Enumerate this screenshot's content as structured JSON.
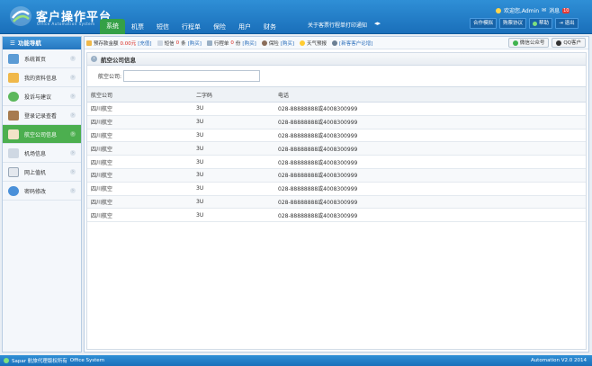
{
  "app": {
    "title": "客户操作平台",
    "subtitle": "Office Automation System",
    "welcome": "欢迎您,Admin",
    "messages": "消息",
    "message_count": "10"
  },
  "nav": {
    "tabs": [
      "系统",
      "机票",
      "短信",
      "行程单",
      "保险",
      "用户",
      "财务"
    ],
    "active": 0,
    "notice": "关于客票行程单打印通知"
  },
  "toolbar": {
    "buttons": [
      "合作模拟",
      "购票协议",
      "帮助",
      "退出"
    ]
  },
  "sidebar": {
    "header": "功能导航",
    "items": [
      "系统首页",
      "我的资料信息",
      "投诉与建议",
      "登录记录查看",
      "航空公司信息",
      "机场信息",
      "网上值机",
      "密码修改"
    ],
    "active": 4
  },
  "quickbar": {
    "deposit_label": "预存款金额",
    "deposit_value": "0.00元",
    "deposit_link": "[充值]",
    "sms_label": "短信",
    "sms_value": "0",
    "sms_unit": "条",
    "sms_link": "[购买]",
    "itinerary_label": "行程单",
    "itinerary_value": "0",
    "itinerary_unit": "份",
    "itinerary_link": "[购买]",
    "insurance_label": "保险",
    "insurance_link": "[购买]",
    "weather": "天气预报",
    "new_customer": "[新客客户论增]",
    "wechat": "微信公众号",
    "qq": "QQ客户"
  },
  "panel": {
    "title": "航空公司信息",
    "search_label": "航空公司:",
    "search_value": ""
  },
  "table": {
    "headers": [
      "航空公司",
      "二字码",
      "电话"
    ],
    "rows": [
      [
        "四川航空",
        "3U",
        "028-88888888或4008300999"
      ],
      [
        "四川航空",
        "3U",
        "028-88888888或4008300999"
      ],
      [
        "四川航空",
        "3U",
        "028-88888888或4008300999"
      ],
      [
        "四川航空",
        "3U",
        "028-88888888或4008300999"
      ],
      [
        "四川航空",
        "3U",
        "028-88888888或4008300999"
      ],
      [
        "四川航空",
        "3U",
        "028-88888888或4008300999"
      ],
      [
        "四川航空",
        "3U",
        "028-88888888或4008300999"
      ],
      [
        "四川航空",
        "3U",
        "028-88888888或4008300999"
      ],
      [
        "四川航空",
        "3U",
        "028-88888888或4008300999"
      ]
    ]
  },
  "footer": {
    "copyright": "Sapar 航旅代理版权所有",
    "system": "Office System",
    "version_label": "Automation",
    "version": "V2.0 2014"
  },
  "colors": {
    "header_blue": "#1a6fba",
    "active_green": "#4caf4f"
  }
}
